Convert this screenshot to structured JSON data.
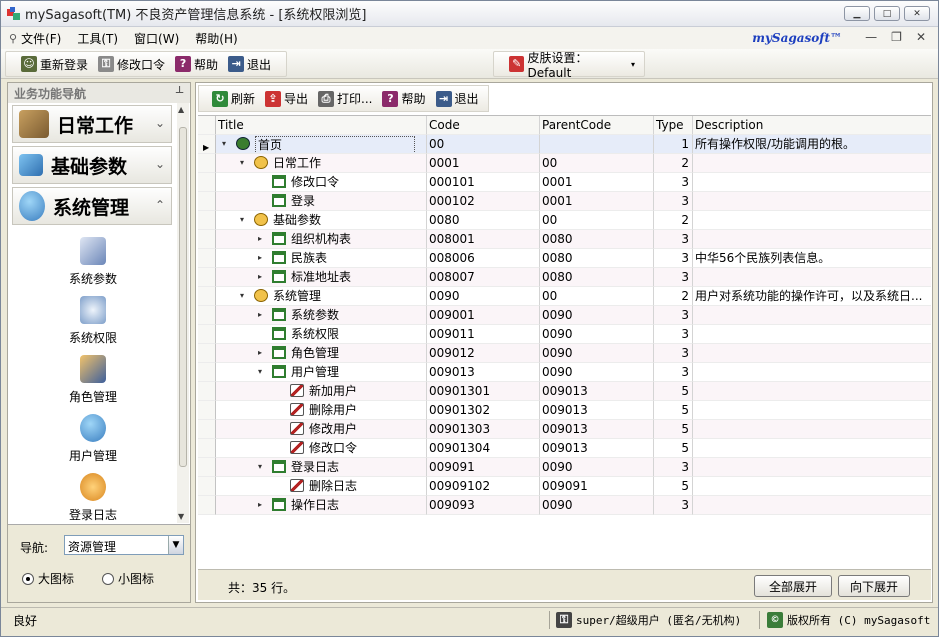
{
  "window": {
    "title": "mySagasoft(TM) 不良资产管理信息系统 - [系统权限浏览]"
  },
  "menu": {
    "items": [
      {
        "label": "文件(F)",
        "icon": "file-menu-icon"
      },
      {
        "label": "工具(T)",
        "icon": ""
      },
      {
        "label": "窗口(W)",
        "icon": ""
      },
      {
        "label": "帮助(H)",
        "icon": ""
      }
    ],
    "brand": "mySagasoft™"
  },
  "toolbar1": {
    "relogin": "重新登录",
    "change_password": "修改口令",
    "help": "帮助",
    "exit": "退出",
    "skin_label": "皮肤设置：Default"
  },
  "left": {
    "header": "业务功能导航",
    "groups": [
      {
        "label": "日常工作",
        "chev": "⌄"
      },
      {
        "label": "基础参数",
        "chev": "⌄"
      },
      {
        "label": "系统管理",
        "chev": "⌃"
      }
    ],
    "items": [
      "系统参数",
      "系统权限",
      "角色管理",
      "用户管理",
      "登录日志"
    ],
    "nav_label": "导航:",
    "nav_value": "资源管理",
    "radio_large": "大图标",
    "radio_small": "小图标"
  },
  "toolbar2": {
    "refresh": "刷新",
    "export": "导出",
    "print": "打印...",
    "help": "帮助",
    "exit": "退出"
  },
  "grid": {
    "columns": [
      "Title",
      "Code",
      "ParentCode",
      "Type",
      "Description"
    ],
    "rows": [
      {
        "title": "首页",
        "code": "00",
        "parent": "",
        "type": "1",
        "desc": "所有操作权限/功能调用的根。",
        "level": 0,
        "expander": "▾",
        "icon": "root"
      },
      {
        "title": "日常工作",
        "code": "0001",
        "parent": "00",
        "type": "2",
        "desc": "",
        "level": 1,
        "expander": "▾",
        "icon": "gear"
      },
      {
        "title": "修改口令",
        "code": "000101",
        "parent": "0001",
        "type": "3",
        "desc": "",
        "level": 2,
        "expander": "",
        "icon": "form"
      },
      {
        "title": "登录",
        "code": "000102",
        "parent": "0001",
        "type": "3",
        "desc": "",
        "level": 2,
        "expander": "",
        "icon": "form"
      },
      {
        "title": "基础参数",
        "code": "0080",
        "parent": "00",
        "type": "2",
        "desc": "",
        "level": 1,
        "expander": "▾",
        "icon": "gear"
      },
      {
        "title": "组织机构表",
        "code": "008001",
        "parent": "0080",
        "type": "3",
        "desc": "",
        "level": 2,
        "expander": "▸",
        "icon": "form"
      },
      {
        "title": "民族表",
        "code": "008006",
        "parent": "0080",
        "type": "3",
        "desc": "中华56个民族列表信息。",
        "level": 2,
        "expander": "▸",
        "icon": "form"
      },
      {
        "title": "标准地址表",
        "code": "008007",
        "parent": "0080",
        "type": "3",
        "desc": "",
        "level": 2,
        "expander": "▸",
        "icon": "form"
      },
      {
        "title": "系统管理",
        "code": "0090",
        "parent": "00",
        "type": "2",
        "desc": "用户对系统功能的操作许可，以及系统日...",
        "level": 1,
        "expander": "▾",
        "icon": "gear"
      },
      {
        "title": "系统参数",
        "code": "009001",
        "parent": "0090",
        "type": "3",
        "desc": "",
        "level": 2,
        "expander": "▸",
        "icon": "form"
      },
      {
        "title": "系统权限",
        "code": "009011",
        "parent": "0090",
        "type": "3",
        "desc": "",
        "level": 2,
        "expander": "",
        "icon": "form"
      },
      {
        "title": "角色管理",
        "code": "009012",
        "parent": "0090",
        "type": "3",
        "desc": "",
        "level": 2,
        "expander": "▸",
        "icon": "form"
      },
      {
        "title": "用户管理",
        "code": "009013",
        "parent": "0090",
        "type": "3",
        "desc": "",
        "level": 2,
        "expander": "▾",
        "icon": "form"
      },
      {
        "title": "新加用户",
        "code": "00901301",
        "parent": "009013",
        "type": "5",
        "desc": "",
        "level": 3,
        "expander": "",
        "icon": "key"
      },
      {
        "title": "删除用户",
        "code": "00901302",
        "parent": "009013",
        "type": "5",
        "desc": "",
        "level": 3,
        "expander": "",
        "icon": "key"
      },
      {
        "title": "修改用户",
        "code": "00901303",
        "parent": "009013",
        "type": "5",
        "desc": "",
        "level": 3,
        "expander": "",
        "icon": "key"
      },
      {
        "title": "修改口令",
        "code": "00901304",
        "parent": "009013",
        "type": "5",
        "desc": "",
        "level": 3,
        "expander": "",
        "icon": "key"
      },
      {
        "title": "登录日志",
        "code": "009091",
        "parent": "0090",
        "type": "3",
        "desc": "",
        "level": 2,
        "expander": "▾",
        "icon": "form"
      },
      {
        "title": "删除日志",
        "code": "00909102",
        "parent": "009091",
        "type": "5",
        "desc": "",
        "level": 3,
        "expander": "",
        "icon": "key"
      },
      {
        "title": "操作日志",
        "code": "009093",
        "parent": "0090",
        "type": "3",
        "desc": "",
        "level": 2,
        "expander": "▸",
        "icon": "form"
      }
    ]
  },
  "footer": {
    "count": "共：35 行。",
    "expand_all": "全部展开",
    "expand_down": "向下展开"
  },
  "status": {
    "state": "良好",
    "user": "super/超级用户 (匿名/无机构)",
    "copyright": "版权所有 (C) mySagasoft"
  },
  "colors": {
    "brand": "#1d3fbf",
    "selected_row": "#e6ecf9",
    "alt_row": "#fbf5f8"
  }
}
